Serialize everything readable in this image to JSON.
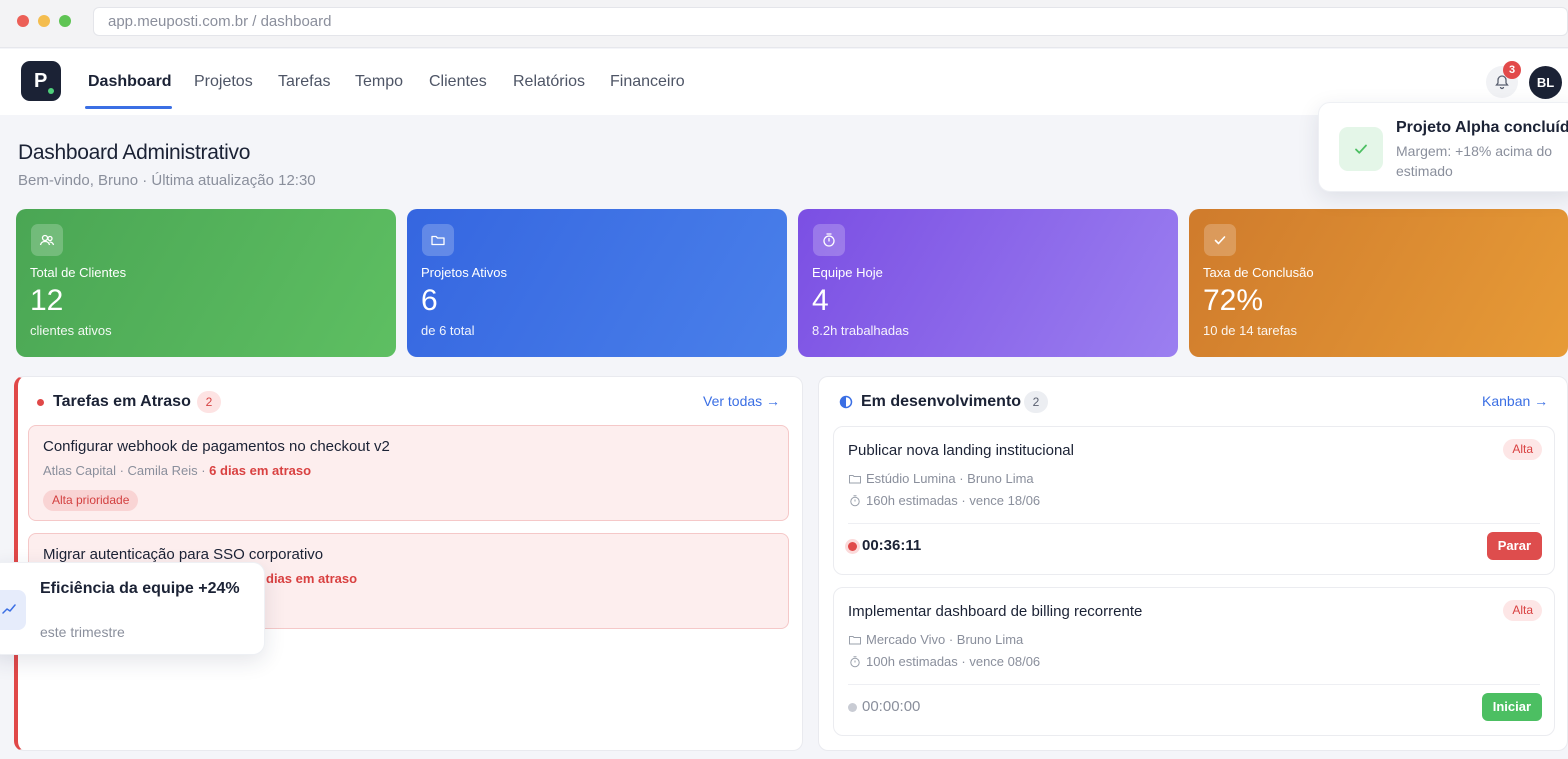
{
  "browser": {
    "url": "app.meuposti.com.br / dashboard"
  },
  "nav": {
    "logo": "P",
    "items": [
      {
        "label": "Dashboard",
        "active": true
      },
      {
        "label": "Projetos"
      },
      {
        "label": "Tarefas"
      },
      {
        "label": "Tempo"
      },
      {
        "label": "Clientes"
      },
      {
        "label": "Relatórios"
      },
      {
        "label": "Financeiro"
      }
    ],
    "notifications": "3",
    "avatar": "BL"
  },
  "header": {
    "title": "Dashboard Administrativo",
    "subtitle": "Bem-vindo, Bruno · Última atualização 12:30"
  },
  "stats": [
    {
      "label": "Total de Clientes",
      "value": "12",
      "foot": "clientes ativos",
      "icon": "users-icon"
    },
    {
      "label": "Projetos Ativos",
      "value": "6",
      "foot": "de 6 total",
      "icon": "folder-icon"
    },
    {
      "label": "Equipe Hoje",
      "value": "4",
      "foot": "8.2h trabalhadas",
      "icon": "stopwatch-icon"
    },
    {
      "label": "Taxa de Conclusão",
      "value": "72%",
      "foot": "10 de 14 tarefas",
      "icon": "check-icon"
    }
  ],
  "overdue": {
    "title": "Tarefas em Atraso",
    "count": "2",
    "link": "Ver todas →",
    "items": [
      {
        "title": "Configurar webhook de pagamentos no checkout v2",
        "meta": "Atlas Capital · Camila Reis · ",
        "late": "6 dias em atraso",
        "badge": "Alta prioridade"
      },
      {
        "title": "Migrar autenticação para SSO corporativo",
        "late": "dias em atraso"
      }
    ]
  },
  "dev": {
    "title": "Em desenvolvimento",
    "count": "2",
    "link": "Kanban →",
    "items": [
      {
        "title": "Publicar nova landing institucional",
        "badge": "Alta",
        "client": "Estúdio Lumina · Bruno Lima",
        "estimate": "160h estimadas · vence 18/06",
        "timer": "00:36:11",
        "action": "Parar"
      },
      {
        "title": "Implementar dashboard de billing recorrente",
        "badge": "Alta",
        "client": "Mercado Vivo · Bruno Lima",
        "estimate": "100h estimadas · vence 08/06",
        "timer": "00:00:00",
        "action": "Iniciar"
      }
    ]
  },
  "toast": {
    "title": "Projeto Alpha concluíd",
    "subtitle": "Margem: +18% acima do estimado"
  },
  "efficiency": {
    "title": "Eficiência da equipe +24%",
    "subtitle": "este trimestre"
  },
  "colors": {
    "accent": "#3b6fe4",
    "danger": "#e04848",
    "success": "#4cbf62",
    "card_green": "#4aa654",
    "card_blue": "#3566e0",
    "card_purple": "#7b4fe3",
    "card_orange": "#cf7b2c"
  }
}
